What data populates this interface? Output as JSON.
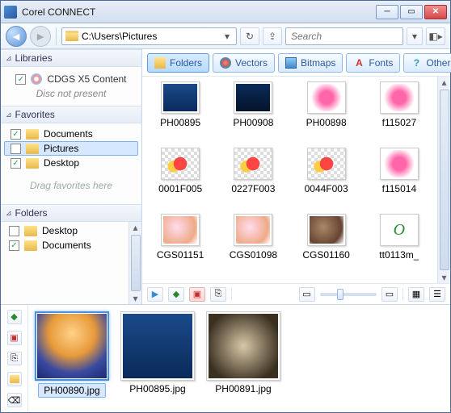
{
  "window": {
    "title": "Corel CONNECT"
  },
  "nav": {
    "path": "C:\\Users\\Pictures",
    "search_placeholder": "Search"
  },
  "libraries": {
    "header": "Libraries",
    "item_label": "CDGS X5 Content",
    "disc_msg": "Disc not present"
  },
  "favorites": {
    "header": "Favorites",
    "items": [
      {
        "label": "Documents",
        "checked": true
      },
      {
        "label": "Pictures",
        "checked": false,
        "selected": true
      },
      {
        "label": "Desktop",
        "checked": true
      }
    ],
    "drag_hint": "Drag favorites here"
  },
  "folders": {
    "header": "Folders",
    "items": [
      {
        "label": "Desktop",
        "checked": false
      },
      {
        "label": "Documents",
        "checked": true
      }
    ]
  },
  "filters": {
    "folders": "Folders",
    "vectors": "Vectors",
    "bitmaps": "Bitmaps",
    "fonts": "Fonts",
    "other": "Other"
  },
  "grid": [
    {
      "name": "PH00895",
      "style": "ocean"
    },
    {
      "name": "PH00908",
      "style": "ocean-dark"
    },
    {
      "name": "PH00898",
      "style": "pink-flower"
    },
    {
      "name": "f115027",
      "style": "pink-flower"
    },
    {
      "name": "0001F005",
      "style": "flower-checker"
    },
    {
      "name": "0227F003",
      "style": "flower-checker"
    },
    {
      "name": "0044F003",
      "style": "flower-checker"
    },
    {
      "name": "f115014",
      "style": "pink-flower"
    },
    {
      "name": "CGS01151",
      "style": "shell"
    },
    {
      "name": "CGS01098",
      "style": "shell"
    },
    {
      "name": "CGS01160",
      "style": "shell-dark"
    },
    {
      "name": "tt0113m_",
      "style": "font-doc"
    }
  ],
  "tray": [
    {
      "name": "PH00890.jpg",
      "style": "jellyfish",
      "selected": true
    },
    {
      "name": "PH00895.jpg",
      "style": "ocean"
    },
    {
      "name": "PH00891.jpg",
      "style": "starfish"
    }
  ]
}
